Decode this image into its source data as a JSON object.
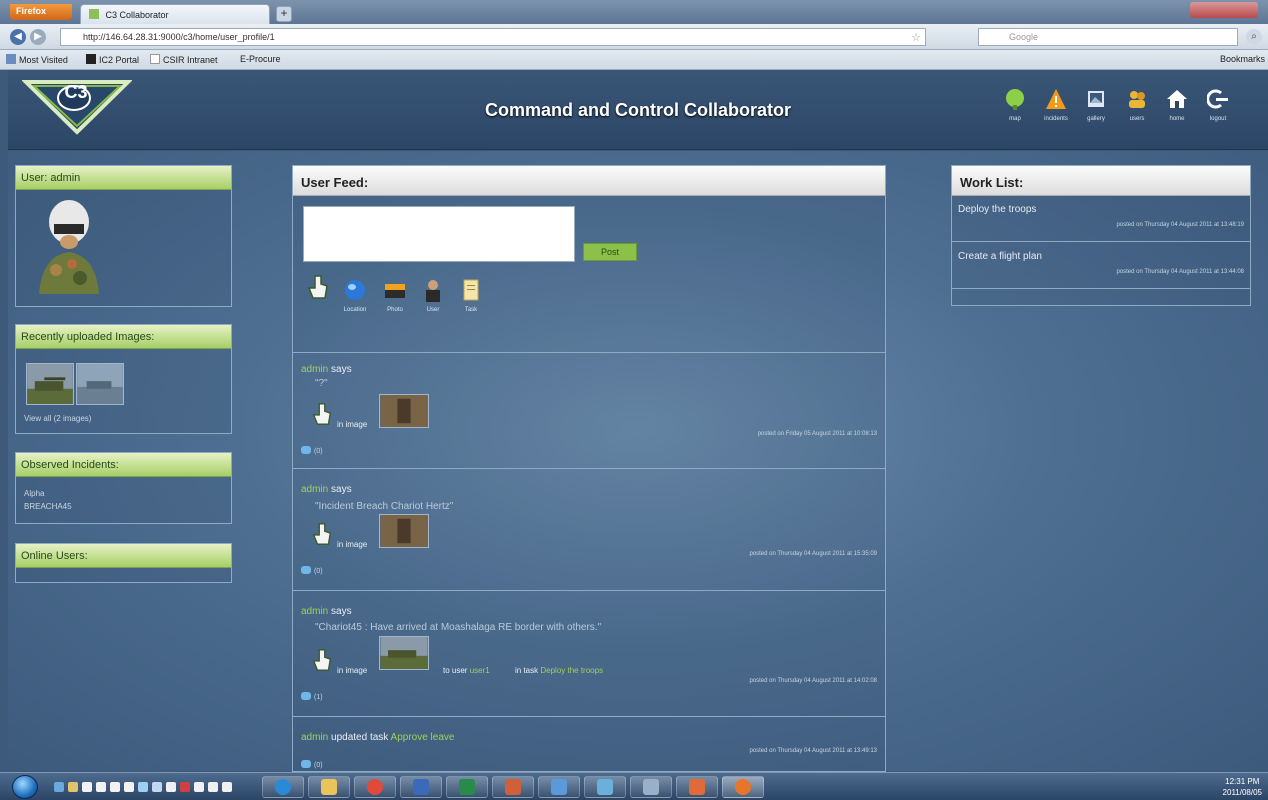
{
  "browser": {
    "menu_label": "Firefox",
    "tab_title": "C3 Collaborator",
    "new_tab": "+",
    "url": "http://146.64.28.31:9000/c3/home/user_profile/1",
    "search_placeholder": "Google",
    "bookmarks": [
      "Most Visited",
      "IC2 Portal",
      "CSIR Intranet",
      "E-Procure"
    ],
    "bookmarks_menu": "Bookmarks"
  },
  "app": {
    "logo_text": "C3",
    "title": "Command and Control Collaborator",
    "header_icons": [
      {
        "name": "map-icon",
        "label": "map",
        "color": "#8cd04a"
      },
      {
        "name": "incidents-icon",
        "label": "incidents",
        "color": "#f29a1a"
      },
      {
        "name": "gallery-icon",
        "label": "gallery",
        "color": "#dfe8f2"
      },
      {
        "name": "users-icon",
        "label": "users",
        "color": "#e9b638"
      },
      {
        "name": "home-icon",
        "label": "home",
        "color": "#ffffff"
      },
      {
        "name": "logout-icon",
        "label": "logout",
        "color": "#ffffff"
      }
    ]
  },
  "sidebar": {
    "user_heading": "User: admin",
    "recent_heading": "Recently uploaded Images:",
    "view_all": "View all (2 images)",
    "incidents_heading": "Observed Incidents:",
    "incidents": [
      "Alpha",
      "BREACHA45"
    ],
    "online_heading": "Online Users:"
  },
  "feed": {
    "heading": "User Feed:",
    "post_button": "Post",
    "tools": [
      "Location",
      "Photo",
      "User",
      "Task"
    ],
    "posts": [
      {
        "user": "admin",
        "verb": "says",
        "quote": "\"?\"",
        "in_image": "in image",
        "stamp": "posted on Friday 05 August 2011 at 10:08:13",
        "comments": "(0)"
      },
      {
        "user": "admin",
        "verb": "says",
        "quote": "\"Incident Breach Chariot Hertz\"",
        "in_image": "in image",
        "stamp": "posted on Thursday 04 August 2011 at 15:35:09",
        "comments": "(0)"
      },
      {
        "user": "admin",
        "verb": "says",
        "quote": "\"Chariot45 : Have arrived at Moashalaga RE border with others.\"",
        "in_image": "in image",
        "in_user_label": "to user",
        "in_user": "user1",
        "in_task_label": "in task",
        "in_task": "Deploy the troops",
        "stamp": "posted on Thursday 04 August 2011 at 14:02:08",
        "comments": "(1)"
      },
      {
        "user": "admin",
        "verb": "updated task",
        "task": "Approve leave",
        "stamp": "posted on Thursday 04 August 2011 at 13:49:13",
        "comments": "(0)"
      }
    ]
  },
  "worklist": {
    "heading": "Work List:",
    "items": [
      {
        "title": "Deploy the troops",
        "stamp": "posted on Thursday 04 August 2011 at 13:48:19"
      },
      {
        "title": "Create a flight plan",
        "stamp": "posted on Thursday 04 August 2011 at 13:44:08"
      }
    ]
  },
  "taskbar": {
    "time": "12:31 PM",
    "date": "2011/08/05"
  }
}
